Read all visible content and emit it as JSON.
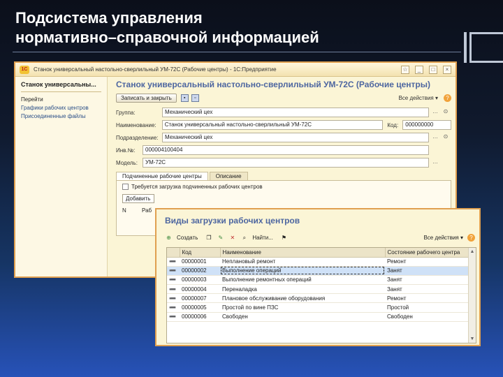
{
  "slide": {
    "title_line1": "Подсистема управления",
    "title_line2": "нормативно–справочной информацией"
  },
  "window1": {
    "logo": "1C",
    "titlebar": "Станок универсальный настольно-сверлильный УМ-72С (Рабочие центры) - 1С:Предприятие",
    "left_panel": {
      "heading": "Станок универсальны...",
      "links": [
        "Перейти",
        "Графики рабочих центров",
        "Присоединенные файлы"
      ]
    },
    "form_title": "Станок универсальный настольно-сверлильный УМ-72С (Рабочие центры)",
    "save_button": "Записать и закрыть",
    "all_actions": "Все действия ▾",
    "help": "?",
    "fields": {
      "group_label": "Группа:",
      "group_value": "Механический цех",
      "name_label": "Наименование:",
      "name_value": "Станок универсальный настольно-сверлильный УМ-72С",
      "code_label": "Код:",
      "code_value": "000000000",
      "division_label": "Подразделение:",
      "division_value": "Механический цех",
      "inv_label": "Инв.№:",
      "inv_value": "000004100404",
      "model_label": "Модель:",
      "model_value": "УМ-72С"
    },
    "tabs": [
      "Подчиненные рабочие центры",
      "Описание"
    ],
    "tab_body": {
      "checkbox_label": "Требуется загрузка подчиненных рабочих центров",
      "button": "Добавить",
      "col_n": "N",
      "col_rab": "Раб"
    }
  },
  "window2": {
    "title": "Виды загрузки рабочих центров",
    "toolbar": {
      "create": "Создать",
      "find": "Найти...",
      "all_actions": "Все действия ▾",
      "help": "?"
    },
    "columns": [
      "Код",
      "Наименование",
      "Состояние рабочего центра"
    ],
    "rows": [
      {
        "code": "00000001",
        "name": "Неплановый ремонт",
        "state": "Ремонт",
        "selected": false
      },
      {
        "code": "00000002",
        "name": "Выполнение операций",
        "state": "Занят",
        "selected": true
      },
      {
        "code": "00000003",
        "name": "Выполнение ремонтных операций",
        "state": "Занят",
        "selected": false
      },
      {
        "code": "00000004",
        "name": "Переналадка",
        "state": "Занят",
        "selected": false
      },
      {
        "code": "00000007",
        "name": "Плановое обслуживание оборудования",
        "state": "Ремонт",
        "selected": false
      },
      {
        "code": "00000005",
        "name": "Простой по вине ПЗС",
        "state": "Простой",
        "selected": false
      },
      {
        "code": "00000006",
        "name": "Свободен",
        "state": "Свободен",
        "selected": false
      }
    ]
  },
  "colors": {
    "accent_title": "#4d66a0",
    "window_border": "#e0a050",
    "window_bg": "#fbf5d6",
    "selected_row": "#cfe1f7"
  }
}
